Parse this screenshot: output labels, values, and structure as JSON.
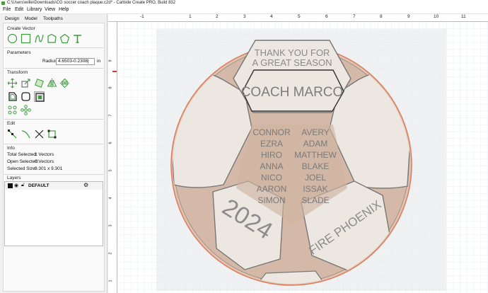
{
  "window": {
    "title": "C:\\Users\\wille\\Downloads\\CG soccer coach plaque.c2d* - Carbide Create PRO, Build 832"
  },
  "menu": [
    "File",
    "Edit",
    "Library",
    "View",
    "Help"
  ],
  "tabs": [
    "Design",
    "Model",
    "Toolpaths"
  ],
  "create_vector": {
    "title": "Create Vector",
    "tools": [
      "circle-icon",
      "rectangle-icon",
      "curve-icon",
      "polyline-icon",
      "polygon-icon",
      "text-icon"
    ]
  },
  "parameters": {
    "title": "Parameters",
    "radius_label": "Radius",
    "radius_value": "4.6503-0.2308|",
    "unit": "in"
  },
  "transform": {
    "title": "Transform"
  },
  "edit": {
    "title": "Edit"
  },
  "info": {
    "title": "Info",
    "total_label": "Total Selected:",
    "total_value": "1 Vectors",
    "open_label": "Open Selected:",
    "open_value": "0 Vectors",
    "size_label": "Selected Size:",
    "size_value": "9.301 x 9.301"
  },
  "layers": {
    "title": "Layers",
    "items": [
      {
        "name": "DEFAULT"
      }
    ]
  },
  "rulers": {
    "top": [
      "-1",
      "1",
      "2",
      "3",
      "4",
      "5",
      "6",
      "7",
      "8",
      "9",
      "10",
      "11"
    ],
    "left": [
      "9",
      "8",
      "7",
      "6",
      "5",
      "4",
      "3",
      "2",
      "1"
    ]
  },
  "plaque": {
    "thank_line1": "THANK YOU FOR",
    "thank_line2": "A GREAT SEASON",
    "coach": "COACH MARCO",
    "names_left": [
      "CONNOR",
      "EZRA",
      "HIRO",
      "ANNA",
      "NICO",
      "AARON",
      "SIMON"
    ],
    "names_right": [
      "AVERY",
      "ADAM",
      "MATTHEW",
      "BLAKE",
      "JOEL",
      "ISSAK",
      "SLADE"
    ],
    "year": "2024",
    "team": "FIRE PHOENIX"
  },
  "colors": {
    "accent_green": "#3b9b3b",
    "wood": "#d4b9a8",
    "panel_fill": "#ece8e1",
    "outline": "#e07b5a"
  }
}
